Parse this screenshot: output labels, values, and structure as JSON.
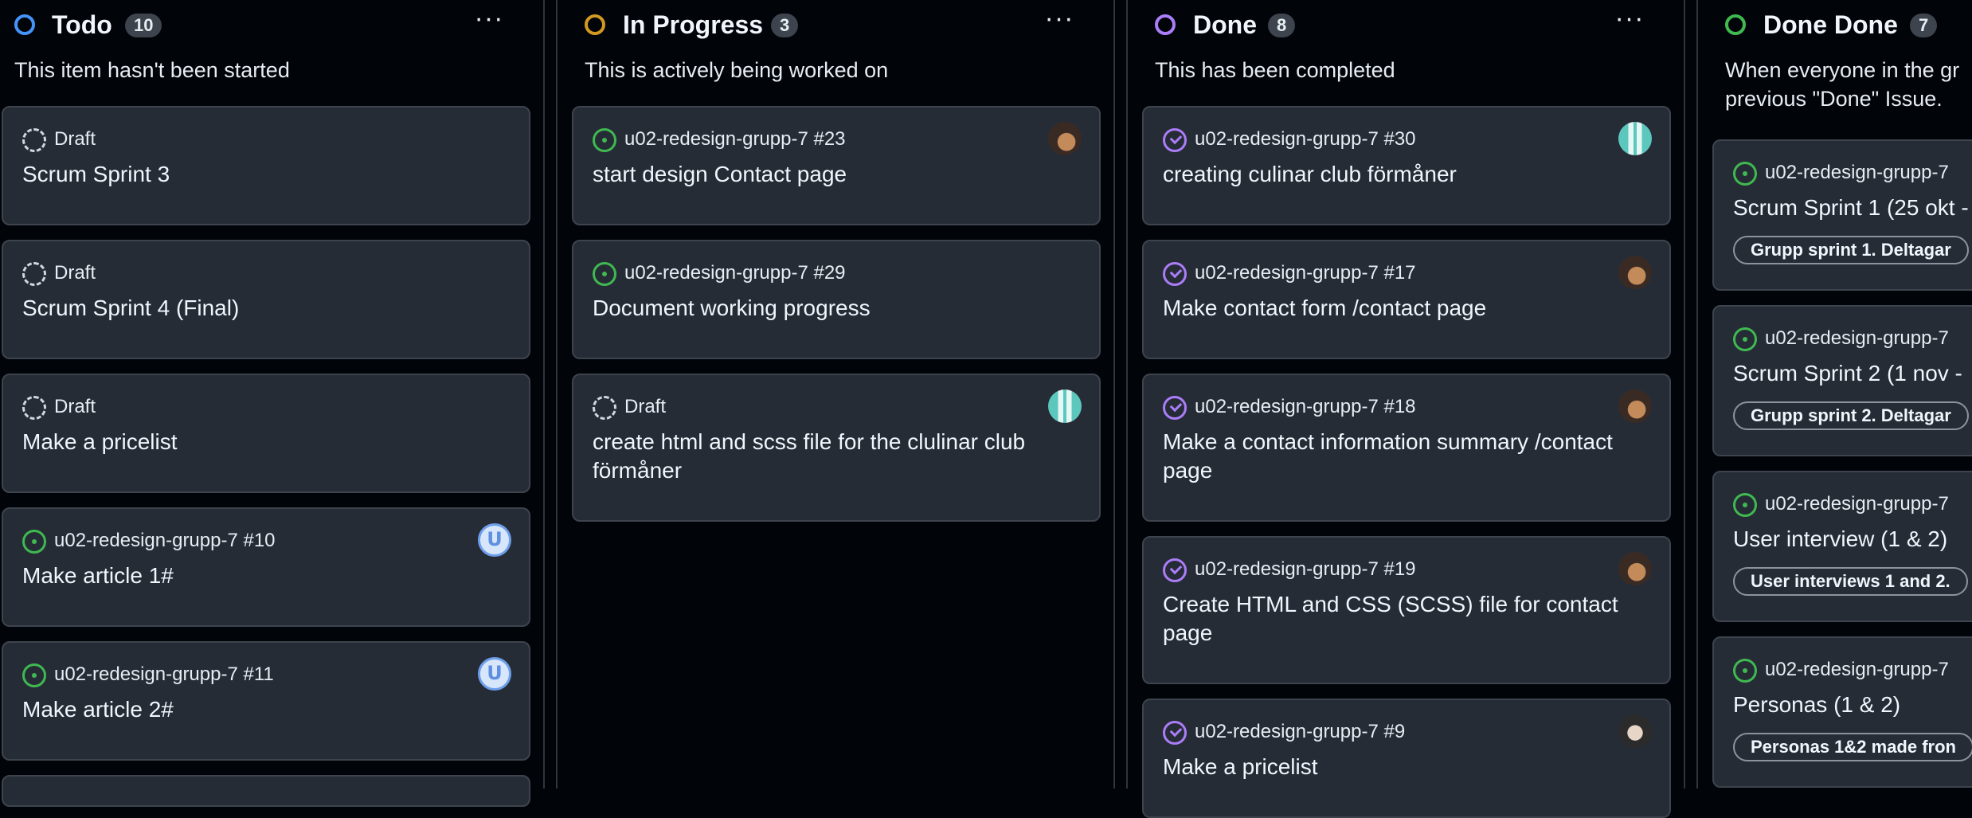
{
  "columns": [
    {
      "title": "Todo",
      "count": "10",
      "description": "This item hasn't been started",
      "ring_color": "#4493f8",
      "cards": [
        {
          "icon": "draft",
          "meta": "Draft",
          "title": "Scrum Sprint 3"
        },
        {
          "icon": "draft",
          "meta": "Draft",
          "title": "Scrum Sprint 4 (Final)"
        },
        {
          "icon": "draft",
          "meta": "Draft",
          "title": "Make a pricelist"
        },
        {
          "icon": "open",
          "meta": "u02-redesign-grupp-7 #10",
          "title": "Make article 1#",
          "avatar": "u-avatar"
        },
        {
          "icon": "open",
          "meta": "u02-redesign-grupp-7 #11",
          "title": "Make article 2#",
          "avatar": "u-avatar"
        }
      ]
    },
    {
      "title": "In Progress",
      "count": "3",
      "description": "This is actively being worked on",
      "ring_color": "#d29922",
      "cards": [
        {
          "icon": "open",
          "meta": "u02-redesign-grupp-7 #23",
          "title": "start design Contact page",
          "avatar": "photo-avatar"
        },
        {
          "icon": "open",
          "meta": "u02-redesign-grupp-7 #29",
          "title": "Document working progress"
        },
        {
          "icon": "draft",
          "meta": "Draft",
          "title": "create html and scss file for the clulinar club förmåner",
          "avatar": "teal-avatar"
        }
      ]
    },
    {
      "title": "Done",
      "count": "8",
      "description": "This has been completed",
      "ring_color": "#ab7df8",
      "cards": [
        {
          "icon": "done",
          "meta": "u02-redesign-grupp-7 #30",
          "title": "creating culinar club förmåner",
          "avatar": "teal-avatar"
        },
        {
          "icon": "done",
          "meta": "u02-redesign-grupp-7 #17",
          "title": "Make contact form /contact page",
          "avatar": "photo-avatar"
        },
        {
          "icon": "done",
          "meta": "u02-redesign-grupp-7 #18",
          "title": "Make a contact information summary /contact page",
          "avatar": "photo-avatar"
        },
        {
          "icon": "done",
          "meta": "u02-redesign-grupp-7 #19",
          "title": "Create HTML and CSS (SCSS) file for contact page",
          "avatar": "photo-avatar"
        },
        {
          "icon": "done",
          "meta": "u02-redesign-grupp-7 #9",
          "title": "Make a pricelist",
          "avatar": "girl-avatar"
        }
      ]
    },
    {
      "title": "Done Done",
      "count": "7",
      "description": "When everyone in the gr\nprevious \"Done\" Issue.",
      "ring_color": "#3fb950",
      "cards": [
        {
          "icon": "open",
          "meta": "u02-redesign-grupp-7",
          "title": "Scrum Sprint 1 (25 okt -",
          "label": "Grupp sprint 1. Deltagar"
        },
        {
          "icon": "open",
          "meta": "u02-redesign-grupp-7",
          "title": "Scrum Sprint 2 (1 nov -",
          "label": "Grupp sprint 2. Deltagar"
        },
        {
          "icon": "open",
          "meta": "u02-redesign-grupp-7",
          "title": "User interview (1 & 2)",
          "label": "User interviews 1 and 2."
        },
        {
          "icon": "open",
          "meta": "u02-redesign-grupp-7",
          "title": "Personas (1 & 2)",
          "label": "Personas 1&2 made fron"
        }
      ]
    }
  ],
  "menu_label": "···"
}
